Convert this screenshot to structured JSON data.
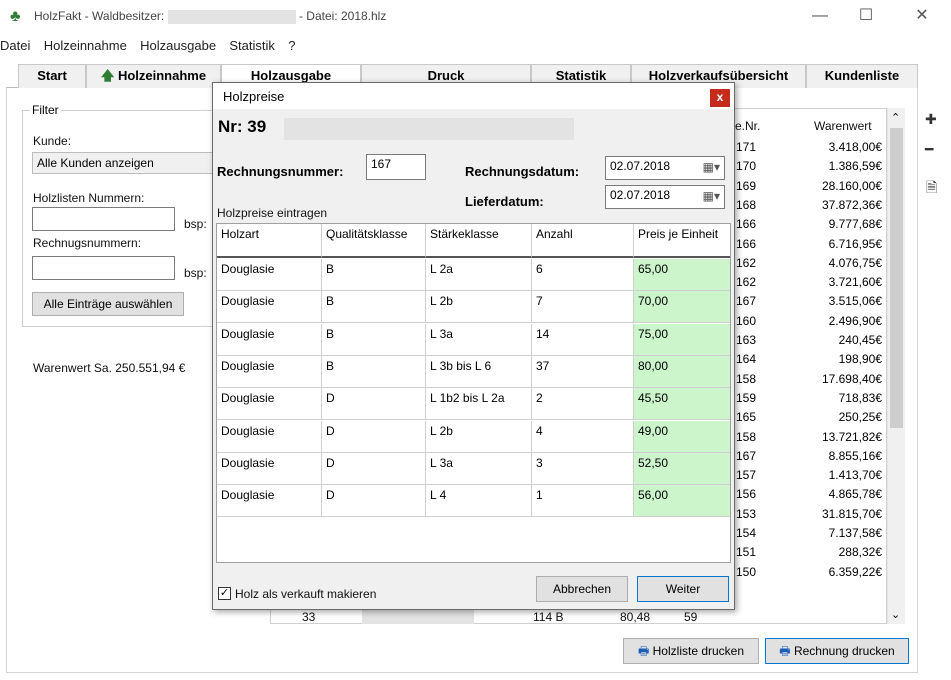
{
  "window": {
    "app_title": "HolzFakt - Waldbesitzer:",
    "file_title": "- Datei: 2018.hlz"
  },
  "menu": [
    "Datei",
    "Holzeinnahme",
    "Holzausgabe",
    "Statistik",
    "?"
  ],
  "tabs": [
    {
      "label": "Start"
    },
    {
      "label": "Holzeinnahme"
    },
    {
      "label": "Holzausgabe"
    },
    {
      "label": "Druck"
    },
    {
      "label": "Statistik"
    },
    {
      "label": "Holzverkaufsübersicht"
    },
    {
      "label": "Kundenliste"
    }
  ],
  "filter": {
    "title": "Filter",
    "kunde_label": "Kunde:",
    "kunde_value": "Alle Kunden anzeigen",
    "holzlisten_label": "Holzlisten Nummern:",
    "holzlisten_hint": "bsp:",
    "rechnung_label": "Rechnugsnummern:",
    "rechnung_hint": "bsp:",
    "select_all_button": "Alle Einträge auswählen"
  },
  "warenwert_sum": "Warenwert Sa. 250.551,94 €",
  "right_table": {
    "col_nr": "e.Nr.",
    "col_warenwert": "Warenwert",
    "rows": [
      {
        "nr": "171",
        "wert": "3.418,00€"
      },
      {
        "nr": "170",
        "wert": "1.386,59€"
      },
      {
        "nr": "169",
        "wert": "28.160,00€"
      },
      {
        "nr": "168",
        "wert": "37.872,36€"
      },
      {
        "nr": "166",
        "wert": "9.777,68€"
      },
      {
        "nr": "166",
        "wert": "6.716,95€"
      },
      {
        "nr": "162",
        "wert": "4.076,75€"
      },
      {
        "nr": "162",
        "wert": "3.721,60€"
      },
      {
        "nr": "167",
        "wert": "3.515,06€"
      },
      {
        "nr": "160",
        "wert": "2.496,90€"
      },
      {
        "nr": "163",
        "wert": "240,45€"
      },
      {
        "nr": "164",
        "wert": "198,90€"
      },
      {
        "nr": "158",
        "wert": "17.698,40€"
      },
      {
        "nr": "159",
        "wert": "718,83€"
      },
      {
        "nr": "165",
        "wert": "250,25€"
      },
      {
        "nr": "158",
        "wert": "13.721,82€"
      },
      {
        "nr": "167",
        "wert": "8.855,16€"
      },
      {
        "nr": "157",
        "wert": "1.413,70€"
      },
      {
        "nr": "156",
        "wert": "4.865,78€"
      },
      {
        "nr": "153",
        "wert": "31.815,70€"
      },
      {
        "nr": "154",
        "wert": "7.137,58€"
      },
      {
        "nr": "151",
        "wert": "288,32€"
      },
      {
        "nr": "150",
        "wert": "6.359,22€"
      }
    ]
  },
  "bottom_row": {
    "c1": "33",
    "c2": "114 B",
    "c3": "80,48",
    "c4": "59"
  },
  "print_buttons": {
    "holzliste": "Holzliste drucken",
    "rechnung": "Rechnung drucken"
  },
  "dialog": {
    "title": "Holzpreise",
    "close": "x",
    "nr_label": "Nr: 39",
    "rechnungsnummer_label": "Rechnungsnummer:",
    "rechnungsnummer_value": "167",
    "rechnungsdatum_label": "Rechnungsdatum:",
    "rechnungsdatum_value": "02.07.2018",
    "lieferdatum_label": "Lieferdatum:",
    "lieferdatum_value": "02.07.2018",
    "section_label": "Holzpreise eintragen",
    "columns": [
      "Holzart",
      "Qualitätsklasse",
      "Stärkeklasse",
      "Anzahl",
      "Preis je Einheit"
    ],
    "rows": [
      [
        "Douglasie",
        "B",
        "L 2a",
        "6",
        "65,00"
      ],
      [
        "Douglasie",
        "B",
        "L 2b",
        "7",
        "70,00"
      ],
      [
        "Douglasie",
        "B",
        "L 3a",
        "14",
        "75,00"
      ],
      [
        "Douglasie",
        "B",
        "L 3b bis L 6",
        "37",
        "80,00"
      ],
      [
        "Douglasie",
        "D",
        "L 1b2 bis L 2a",
        "2",
        "45,50"
      ],
      [
        "Douglasie",
        "D",
        "L 2b",
        "4",
        "49,00"
      ],
      [
        "Douglasie",
        "D",
        "L 3a",
        "3",
        "52,50"
      ],
      [
        "Douglasie",
        "D",
        "L 4",
        "1",
        "56,00"
      ]
    ],
    "checkbox_label": "Holz als verkauft makieren",
    "checkbox_checked": true,
    "cancel_button": "Abbrechen",
    "next_button": "Weiter"
  },
  "colors": {
    "price_cell": "#ccf5cc",
    "close_button": "#c42b1c",
    "accent": "#0078d7"
  }
}
